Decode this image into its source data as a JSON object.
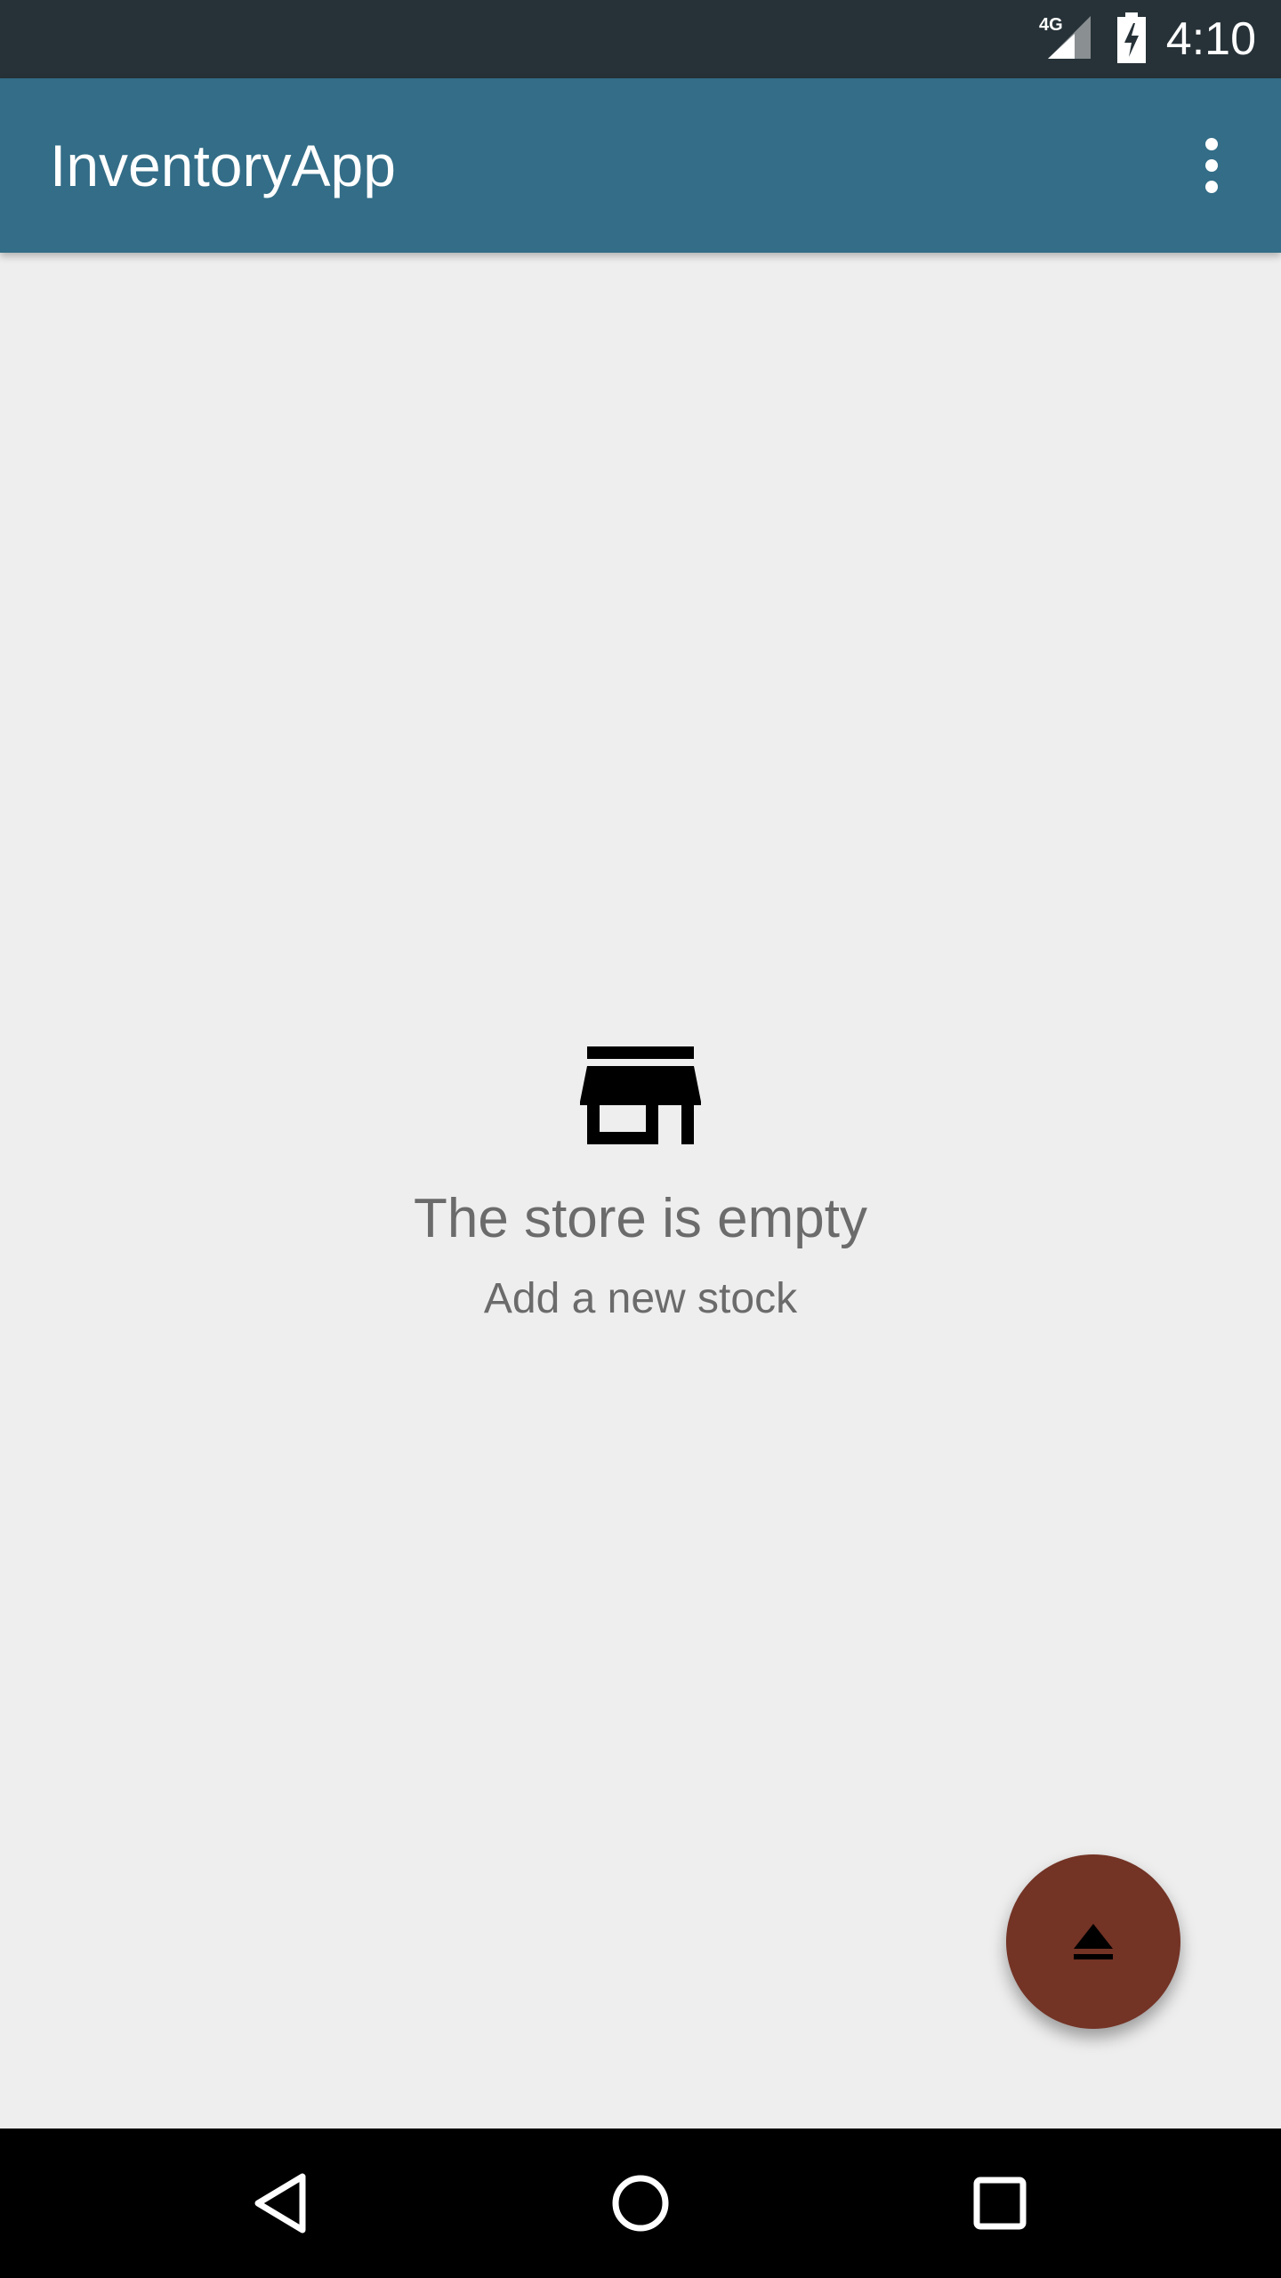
{
  "status_bar": {
    "network": "4G",
    "time": "4:10",
    "icons": [
      "signal-icon",
      "battery-charging-icon"
    ]
  },
  "app_bar": {
    "title": "InventoryApp",
    "menu_icon": "more-vert-icon",
    "color": "#336d87"
  },
  "empty_state": {
    "icon": "store-icon",
    "title": "The store is empty",
    "subtitle": "Add a new stock"
  },
  "fab": {
    "icon": "eject-icon",
    "color": "#733325"
  },
  "nav_bar": {
    "buttons": [
      "back-icon",
      "home-icon",
      "recents-icon"
    ]
  }
}
